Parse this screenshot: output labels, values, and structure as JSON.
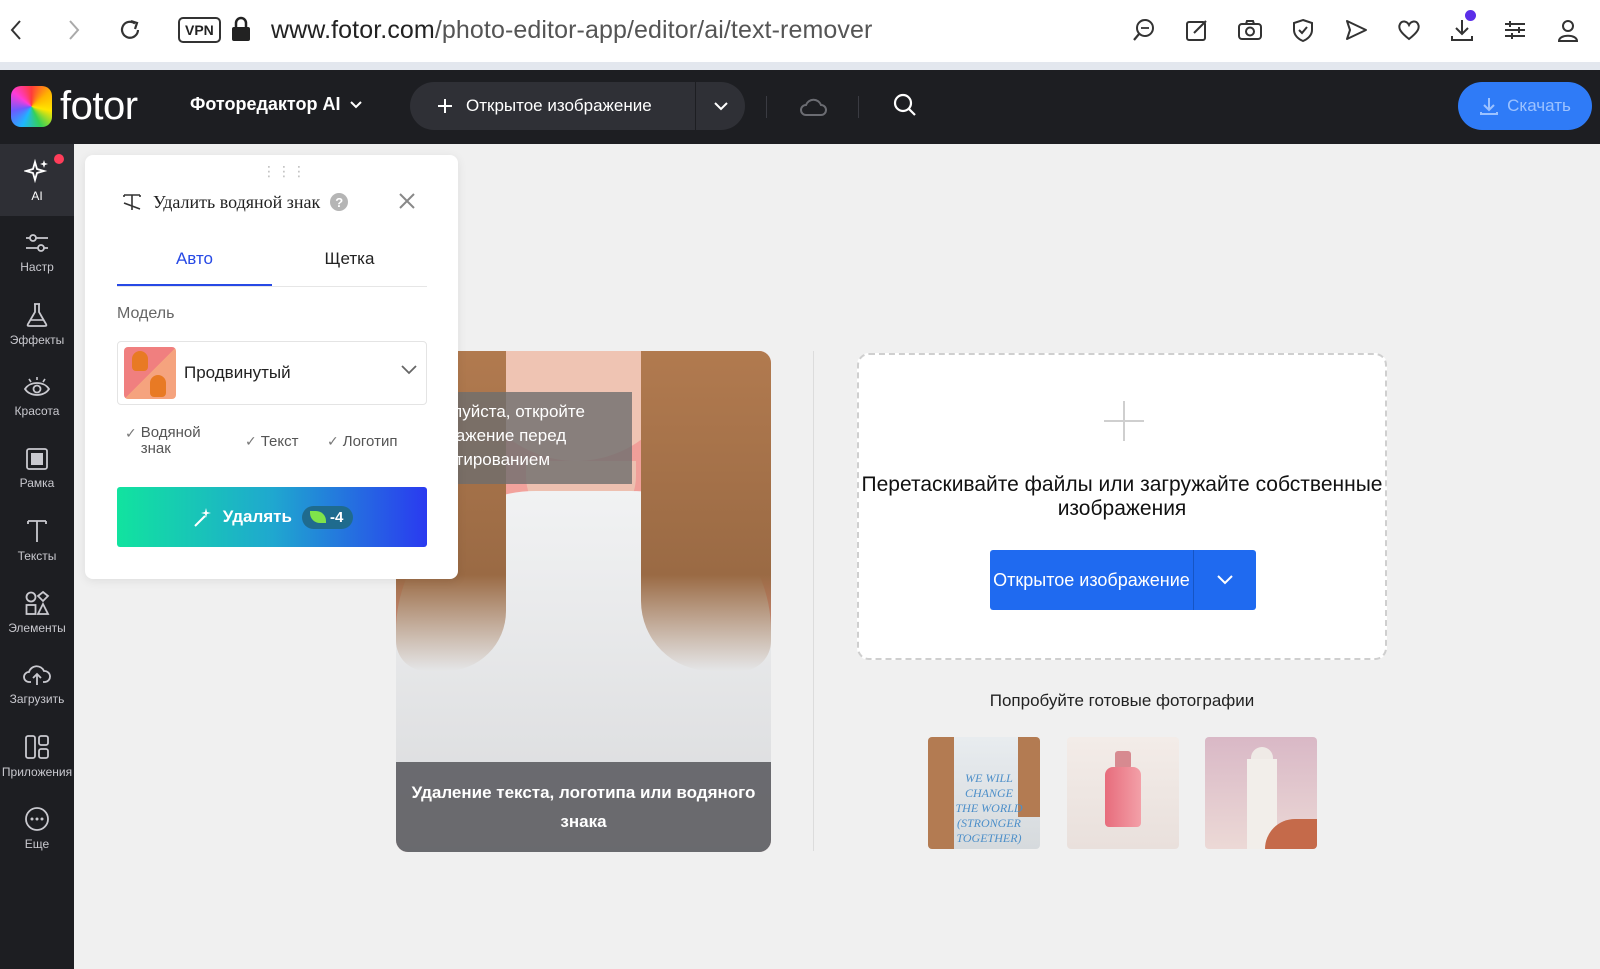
{
  "browser": {
    "vpn_label": "VPN",
    "url_domain": "www.fotor.com",
    "url_path": "/photo-editor-app/editor/ai/text-remover"
  },
  "header": {
    "logo_text": "fotor",
    "app_menu_label": "Фоторедактор AI",
    "open_image_label": "Открытое изображение",
    "download_label": "Скачать"
  },
  "rail": {
    "items": [
      {
        "label": "AI",
        "icon": "ai-sparkle-icon"
      },
      {
        "label": "Настр",
        "icon": "sliders-icon"
      },
      {
        "label": "Эффекты",
        "icon": "flask-icon"
      },
      {
        "label": "Красота",
        "icon": "eye-icon"
      },
      {
        "label": "Рамка",
        "icon": "frame-icon"
      },
      {
        "label": "Тексты",
        "icon": "text-icon"
      },
      {
        "label": "Элементы",
        "icon": "shapes-icon"
      },
      {
        "label": "Загрузить",
        "icon": "upload-cloud-icon"
      },
      {
        "label": "Приложения",
        "icon": "apps-icon"
      },
      {
        "label": "Еще",
        "icon": "more-icon"
      }
    ]
  },
  "panel": {
    "title": "Удалить водяной знак",
    "tabs": [
      {
        "label": "Авто",
        "active": true
      },
      {
        "label": "Щетка",
        "active": false
      }
    ],
    "model_label": "Модель",
    "model_value": "Продвинутый",
    "checks": [
      "Водяной знак",
      "Текст",
      "Логотип"
    ],
    "remove_label": "Удалять",
    "remove_cost": "-4"
  },
  "canvas": {
    "sample_caption": "Удаление текста, логотипа или водяного знака",
    "tooltip": "Пожалуйста, откройте изображение перед редактированием",
    "upload_text": "Перетаскивайте файлы или загружайте собственные изображения",
    "upload_button": "Открытое изображение",
    "try_label": "Попробуйте готовые фотографии",
    "thumb1_text": "WE WILL CHANGE THE WORLD (STRONGER TOGETHER)"
  },
  "colors": {
    "accent_blue": "#2749e5",
    "header_bg": "#1d1e22",
    "download_blue": "#2f7bf7"
  }
}
